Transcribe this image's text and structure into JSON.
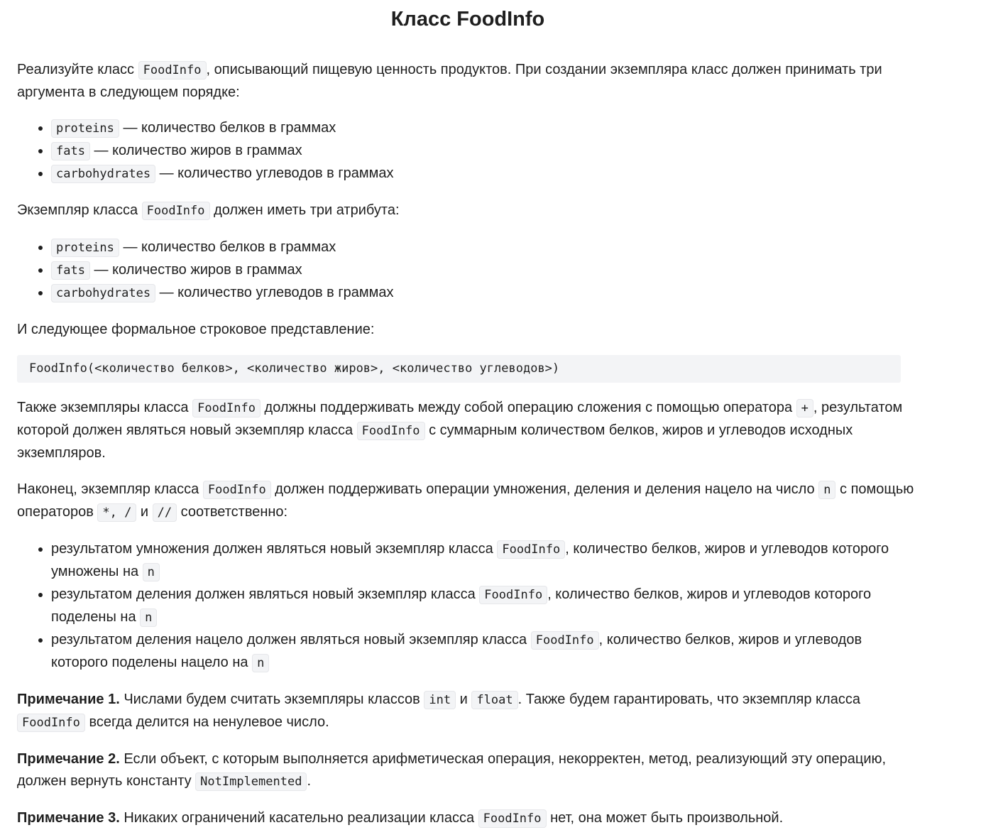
{
  "title": "Класс FoodInfo",
  "intro": {
    "t1": "Реализуйте класс ",
    "code1": "FoodInfo",
    "t2": ", описывающий пищевую ценность продуктов. При создании экземпляра класс должен принимать три аргумента в следующем порядке:"
  },
  "args_list": [
    {
      "code": "proteins",
      "text": " — количество белков в граммах"
    },
    {
      "code": "fats",
      "text": " — количество жиров в граммах"
    },
    {
      "code": "carbohydrates",
      "text": " — количество углеводов в граммах"
    }
  ],
  "attrs_intro": {
    "t1": "Экземпляр класса ",
    "code1": "FoodInfo",
    "t2": " должен иметь три атрибута:"
  },
  "attrs_list": [
    {
      "code": "proteins",
      "text": " — количество белков в граммах"
    },
    {
      "code": "fats",
      "text": " — количество жиров в граммах"
    },
    {
      "code": "carbohydrates",
      "text": " — количество углеводов в граммах"
    }
  ],
  "repr_intro": "И следующее формальное строковое представление:",
  "repr_code": "FoodInfo(<количество белков>, <количество жиров>, <количество углеводов>)",
  "addition": {
    "t1": "Также экземпляры класса ",
    "code1": "FoodInfo",
    "t2": " должны поддерживать между собой операцию сложения с помощью оператора ",
    "code2": "+",
    "t3": ", результатом которой должен являться новый экземпляр класса ",
    "code3": "FoodInfo",
    "t4": " с суммарным количеством белков, жиров и углеводов исходных экземпляров."
  },
  "mult": {
    "t1": "Наконец, экземпляр класса ",
    "code1": "FoodInfo",
    "t2": " должен поддерживать операции умножения, деления и деления нацело на число ",
    "code2": "n",
    "t3": " с помощью операторов ",
    "code3": "*, /",
    "t4": " и ",
    "code4": "//",
    "t5": " соответственно:"
  },
  "ops_list": [
    {
      "t1": "результатом умножения должен являться новый экземпляр класса ",
      "code1": "FoodInfo",
      "t2": ", количество белков, жиров и углеводов которого умножены на ",
      "code2": "n"
    },
    {
      "t1": "результатом деления должен являться новый экземпляр класса ",
      "code1": "FoodInfo",
      "t2": ", количество белков, жиров и углеводов которого поделены на ",
      "code2": "n"
    },
    {
      "t1": "результатом деления нацело должен являться новый экземпляр класса ",
      "code1": "FoodInfo",
      "t2": ", количество белков, жиров и углеводов которого поделены нацело на ",
      "code2": "n"
    }
  ],
  "note1": {
    "label": "Примечание 1.",
    "t1": " Числами будем считать экземпляры классов ",
    "code1": "int",
    "t2": " и ",
    "code2": "float",
    "t3": ". Также будем гарантировать, что экземпляр класса ",
    "code3": "FoodInfo",
    "t4": " всегда делится на ненулевое число."
  },
  "note2": {
    "label": "Примечание 2.",
    "t1": " Если объект, с которым выполняется арифметическая операция, некорректен, метод, реализующий эту операцию, должен вернуть константу ",
    "code1": "NotImplemented",
    "t2": "."
  },
  "note3": {
    "label": "Примечание 3.",
    "t1": " Никаких ограничений касательно реализации класса ",
    "code1": "FoodInfo",
    "t2": " нет, она может быть произвольной."
  }
}
